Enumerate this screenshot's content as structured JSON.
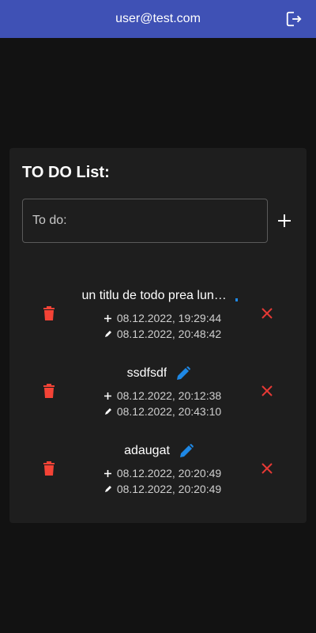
{
  "header": {
    "user_email": "user@test.com",
    "logout_icon": "logout-icon",
    "background_color": "#3f51b5"
  },
  "todo_card": {
    "title": "TO DO List:",
    "input_placeholder": "To do:",
    "input_value": "",
    "add_icon": "plus-icon"
  },
  "todos": [
    {
      "title": "un titlu de todo prea lung …",
      "created": "08.12.2022, 19:29:44",
      "edited": "08.12.2022, 20:48:42",
      "show_edit": false
    },
    {
      "title": "ssdfsdf",
      "created": "08.12.2022, 20:12:38",
      "edited": "08.12.2022, 20:43:10",
      "show_edit": true
    },
    {
      "title": "adaugat",
      "created": "08.12.2022, 20:20:49",
      "edited": "08.12.2022, 20:20:49",
      "show_edit": true
    }
  ],
  "colors": {
    "delete": "#f44336",
    "edit": "#1e88e5",
    "close": "#e53935"
  }
}
